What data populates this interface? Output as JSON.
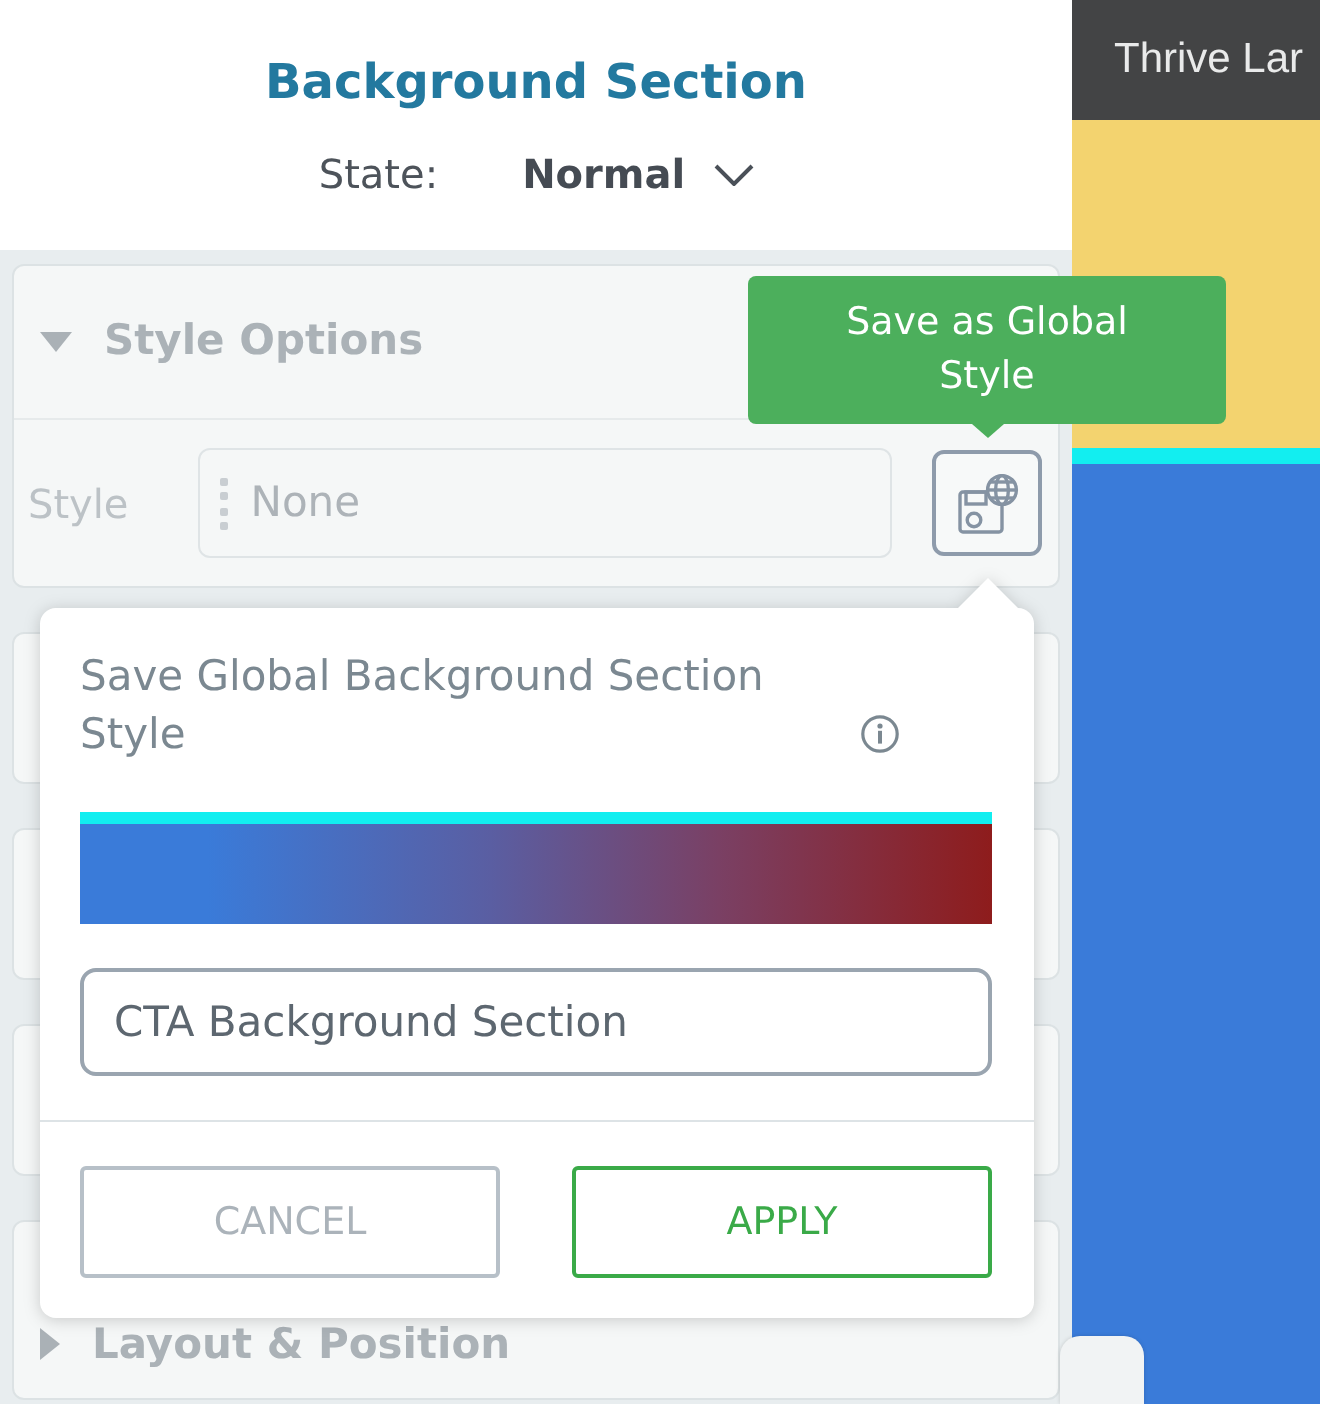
{
  "panel": {
    "title": "Background Section",
    "state": {
      "label": "State:",
      "value": "Normal"
    }
  },
  "sections": [
    {
      "title": "Style Options",
      "expanded": true,
      "style": {
        "label": "Style",
        "value": "None"
      }
    },
    {
      "expanded": false
    },
    {
      "expanded": false
    },
    {
      "expanded": false
    },
    {
      "title": "Layout & Position",
      "expanded": false
    }
  ],
  "tooltip": {
    "text": "Save as Global Style"
  },
  "popover": {
    "title": "Save Global Background Section Style",
    "name_input": {
      "value": "CTA Background Section"
    },
    "buttons": [
      {
        "label": "CANCEL",
        "kind": "cancel"
      },
      {
        "label": "APPLY",
        "kind": "apply"
      }
    ]
  },
  "canvas": {
    "top_bar": {
      "text": "Thrive Lar"
    }
  }
}
